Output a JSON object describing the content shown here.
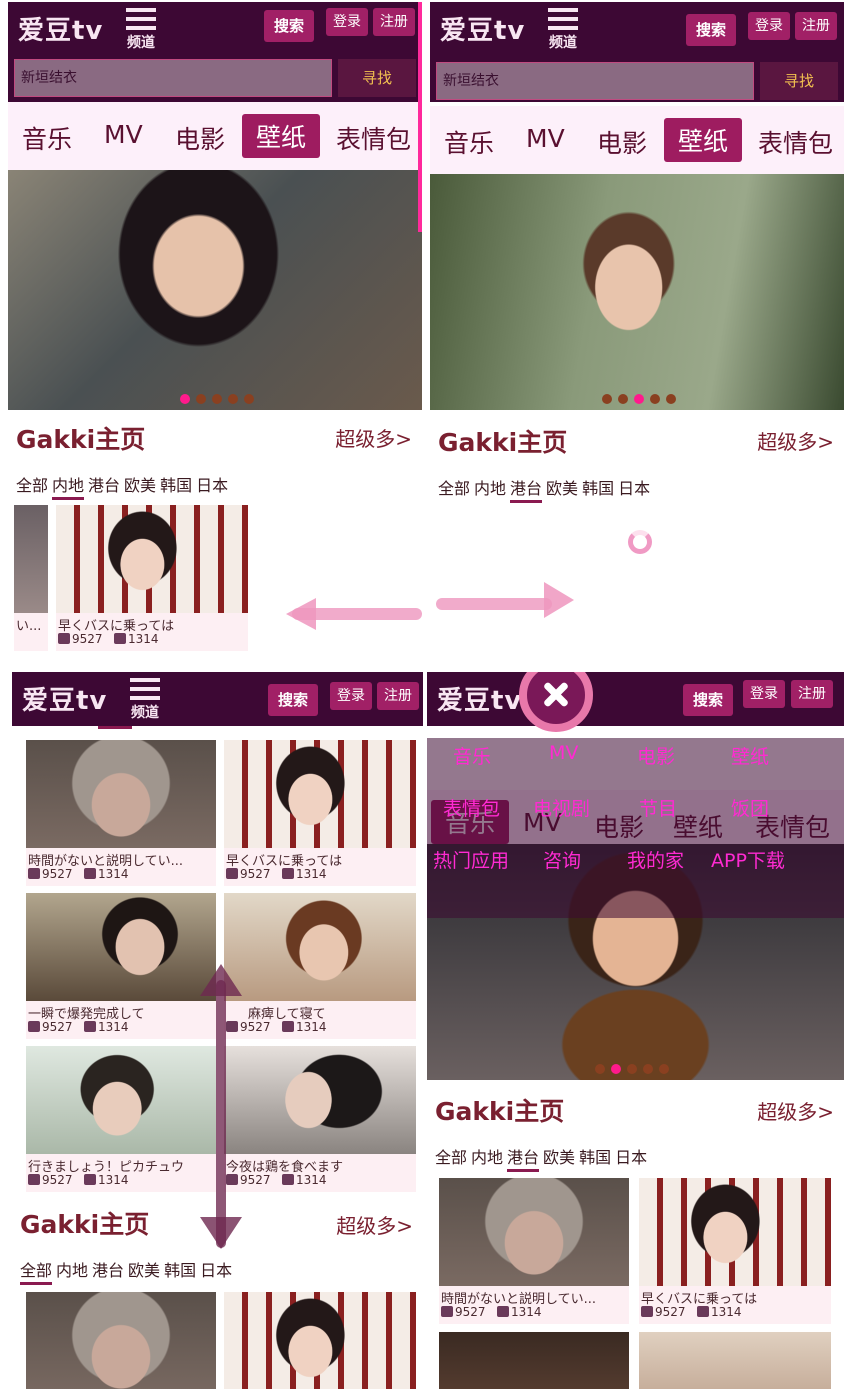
{
  "header": {
    "logo": "爱豆tv",
    "channel": "频道",
    "search_btn": "搜索",
    "login": "登录",
    "register": "注册",
    "search_value": "新垣结衣",
    "find_btn": "寻找"
  },
  "nav": [
    "音乐",
    "MV",
    "电影",
    "壁纸",
    "表情包"
  ],
  "menu": [
    "音乐",
    "MV",
    "电影",
    "壁纸",
    "表情包",
    "电视剧",
    "节目",
    "饭团",
    "热门应用",
    "咨询",
    "我的家",
    "APP下载"
  ],
  "section": {
    "title": "Gakki主页",
    "more": "超级多>"
  },
  "region_tabs": [
    "全部",
    "内地",
    "港台",
    "欧美",
    "韩国",
    "日本"
  ],
  "cards": [
    {
      "caption": "時間がないと説明してい...",
      "plays": "9527",
      "comments": "1314"
    },
    {
      "caption": "早くバスに乗っては",
      "plays": "9527",
      "comments": "1314"
    },
    {
      "caption": "一瞬で爆発完成して",
      "plays": "9527",
      "comments": "1314"
    },
    {
      "caption": "麻痺して寝て",
      "plays": "9527",
      "comments": "1314"
    },
    {
      "caption": "行きましょう！ピカチュウ",
      "plays": "9527",
      "comments": "1314"
    },
    {
      "caption": "今夜は鶏を食べます",
      "plays": "9527",
      "comments": "1314"
    }
  ],
  "p1_left_card_caption": "い...",
  "colors": {
    "header_bg": "#3d0834",
    "accent": "#a12066",
    "nav_bg": "#fdf0fa",
    "title": "#7a2030",
    "menu_text": "#ff2ad2"
  }
}
